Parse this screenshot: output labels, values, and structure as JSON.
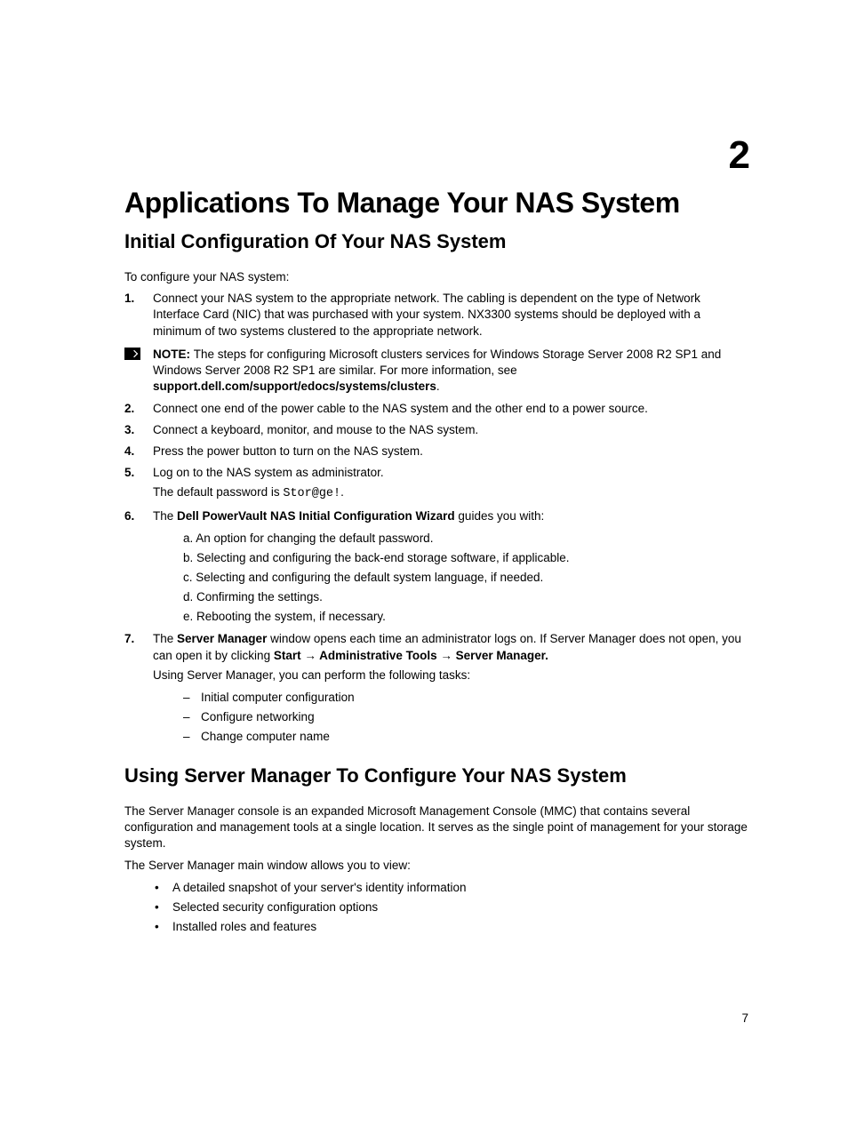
{
  "chapterNumber": "2",
  "title": "Applications To Manage Your NAS System",
  "section1": {
    "heading": "Initial Configuration Of Your NAS System",
    "intro": "To configure your NAS system:",
    "step1": "Connect your NAS system to the appropriate network. The cabling is dependent on the type of Network Interface Card (NIC) that was purchased with your system. NX3300 systems should be deployed with a minimum of two systems clustered to the appropriate network.",
    "noteLabel": "NOTE: ",
    "noteText1": "The steps for configuring Microsoft clusters services for Windows Storage Server 2008 R2 SP1 and Windows Server 2008 R2 SP1 are similar. For more information, see ",
    "noteBold": "support.dell.com/support/edocs/systems/clusters",
    "notePeriod": ".",
    "step2": "Connect one end of the power cable to the NAS system and the other end to a power source.",
    "step3": "Connect a keyboard, monitor, and mouse to the NAS system.",
    "step4": "Press the power button to turn on the NAS system.",
    "step5a": "Log on to the NAS system as administrator.",
    "step5b_pre": "The default password is ",
    "step5b_mono": "Stor@ge!",
    "step5b_post": ".",
    "step6_pre": "The ",
    "step6_bold": "Dell PowerVault NAS Initial Configuration Wizard",
    "step6_post": " guides you with:",
    "step6a": "a.  An option for changing the default password.",
    "step6b": "b.  Selecting and configuring the back-end storage software, if applicable.",
    "step6c": "c.  Selecting and configuring the default system language, if needed.",
    "step6d": "d.  Confirming the settings.",
    "step6e": "e.  Rebooting the system, if necessary.",
    "step7_pre": "The ",
    "step7_bold1": "Server Manager",
    "step7_mid1": " window opens each time an administrator logs on. If Server Manager does not open, you can open it by clicking ",
    "step7_bold2": "Start → Administrative Tools → Server Manager.",
    "step7_line2": "Using Server Manager, you can perform the following tasks:",
    "step7a": "Initial computer configuration",
    "step7b": "Configure networking",
    "step7c": "Change computer name"
  },
  "section2": {
    "heading": "Using Server Manager To Configure Your NAS System",
    "para1": "The Server Manager console is an expanded Microsoft Management Console (MMC) that contains several configuration and management tools at a single location. It serves as the single point of management for your storage system.",
    "para2": "The Server Manager main window allows you to view:",
    "bullet1": "A detailed snapshot of your server's identity information",
    "bullet2": "Selected security configuration options",
    "bullet3": "Installed roles and features"
  },
  "pageNumber": "7"
}
